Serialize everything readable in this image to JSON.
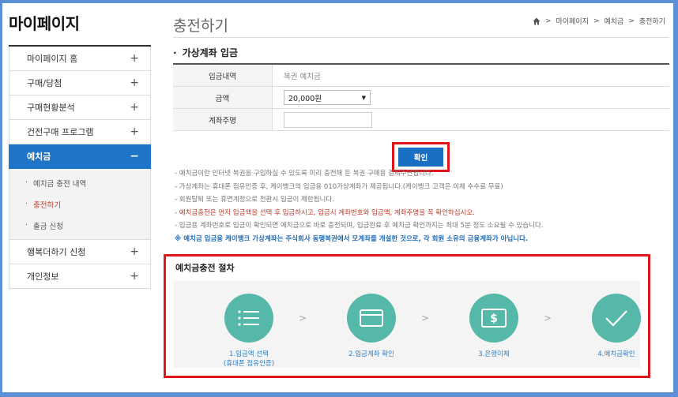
{
  "sidebar": {
    "title": "마이페이지",
    "items": [
      {
        "label": "마이페이지 홈",
        "toggle": "+"
      },
      {
        "label": "구매/당첨",
        "toggle": "+"
      },
      {
        "label": "구매현황분석",
        "toggle": "+"
      },
      {
        "label": "건전구매 프로그램",
        "toggle": "+"
      },
      {
        "label": "예치금",
        "toggle": "−"
      },
      {
        "label": "행복더하기 신청",
        "toggle": "+"
      },
      {
        "label": "개인정보",
        "toggle": "+"
      }
    ],
    "subitems": [
      {
        "label": "예치금 충전 내역"
      },
      {
        "label": "충전하기"
      },
      {
        "label": "출금 신청"
      }
    ]
  },
  "header": {
    "title": "충전하기",
    "breadcrumb": [
      "마이페이지",
      "예치금",
      "충전하기"
    ]
  },
  "section": {
    "title": "가상계좌 입금"
  },
  "form": {
    "row1_label": "입금내역",
    "row1_value": "복권 예치금",
    "row2_label": "금액",
    "row2_value": "20,000원",
    "row3_label": "계좌주명",
    "row3_value": ""
  },
  "confirm_label": "확인",
  "notes": [
    "예치금이란 인터넷 복권을 구입하실 수 있도록 미리 충전해 둔 복권 구매용 결제수단입니다.",
    "가상계좌는 휴대폰 점유인증 후, 케이뱅크의 입금용 010가상계좌가 제공됩니다.(케이뱅크 고객은 이체 수수료 무료)",
    "회원탈퇴 또는 휴면계정으로 전환시 입금이 제한됩니다.",
    "예치금충전은 먼저 입금액을 선택 후 입금하시고, 입금시 계좌번호와 입금액, 계좌주명을 꼭 확인하십시오.",
    "입금용 계좌번호로 입금이 확인되면 예치금으로 바로 충전되며, 입금완료 후 예치금 확인까지는 최대 5분 정도 소요될 수 있습니다.",
    "※ 예치금 입금용 케이뱅크 가상계좌는 주식회사 동행복권에서 모계좌를 개설한 것으로, 각 회원 소유의 금융계좌가 아닙니다."
  ],
  "procedure": {
    "title": "예치금충전 절차",
    "steps": [
      {
        "line1": "1.입금액 선택",
        "line2": "(휴대폰 점유인증)",
        "icon": "list-icon"
      },
      {
        "line1": "2.입금계좌 확인",
        "line2": "",
        "icon": "card-icon"
      },
      {
        "line1": "3.은행이체",
        "line2": "",
        "icon": "dollar-icon"
      },
      {
        "line1": "4.예치금확인",
        "line2": "",
        "icon": "check-icon"
      }
    ]
  },
  "colors": {
    "accent": "#1e74c6",
    "highlight_border": "#e0151b",
    "step_circle": "#56b8a8"
  }
}
